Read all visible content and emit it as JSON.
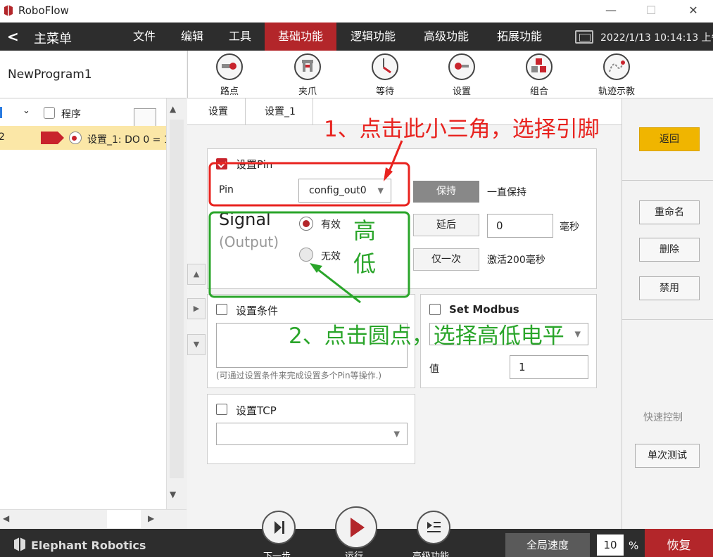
{
  "window": {
    "app_title": "RoboFlow",
    "min": "—",
    "max": "☐",
    "close": "✕"
  },
  "menubar": {
    "back": "<",
    "main_menu": "主菜单",
    "items": [
      "文件",
      "编辑",
      "工具",
      "基础功能",
      "逻辑功能",
      "高级功能",
      "拓展功能"
    ],
    "active_index": 3,
    "datetime": "2022/1/13 10:14:13 上午"
  },
  "program": {
    "name": "NewProgram1"
  },
  "toolbar": {
    "items": [
      {
        "label": "路点",
        "icon": "waypoint-icon"
      },
      {
        "label": "夹爪",
        "icon": "gripper-icon"
      },
      {
        "label": "等待",
        "icon": "wait-icon"
      },
      {
        "label": "设置",
        "icon": "settings-icon"
      },
      {
        "label": "组合",
        "icon": "combine-icon"
      },
      {
        "label": "轨迹示教",
        "icon": "trajectory-icon"
      }
    ]
  },
  "tree": {
    "root_label": "程序",
    "row_number": "2",
    "item_label": "设置_1: DO 0 = 1"
  },
  "tabs": [
    "设置",
    "设置_1"
  ],
  "pin_panel": {
    "title": "设置Pin",
    "pin_label": "Pin",
    "pin_value": "config_out0",
    "keep_button": "保持",
    "keep_desc": "一直保持",
    "delay_button": "延后",
    "delay_value": "0",
    "delay_unit": "毫秒",
    "once_button": "仅一次",
    "once_desc": "激活200毫秒",
    "signal_title": "Signal",
    "signal_sub": "(Output)",
    "radio_valid": "有效",
    "radio_invalid": "无效"
  },
  "condition_panel": {
    "title": "设置条件",
    "note": "(可通过设置条件来完成设置多个Pin等操作.)"
  },
  "modbus_panel": {
    "title": "Set Modbus",
    "value_label": "值",
    "value": "1"
  },
  "tcp_panel": {
    "title": "设置TCP"
  },
  "right_panel": {
    "back": "返回",
    "rename": "重命名",
    "delete": "删除",
    "disable": "禁用",
    "quick_control": "快速控制",
    "single_test": "单次测试"
  },
  "bottom": {
    "brand": "Elephant Robotics",
    "next_step": "下一步",
    "run": "运行",
    "advanced": "高级功能",
    "global_speed": "全局速度",
    "speed_value": "10",
    "percent": "%",
    "restore": "恢复"
  },
  "annotations": {
    "red_note": "1、点击此小三角，选择引脚",
    "green_high": "高",
    "green_low": "低",
    "green_note": "2、点击圆点，选择高低电平"
  },
  "colors": {
    "accent_red": "#b3262a",
    "yellow_button": "#f0b500",
    "annotation_red": "#e8231f",
    "annotation_green": "#2aa52a"
  }
}
